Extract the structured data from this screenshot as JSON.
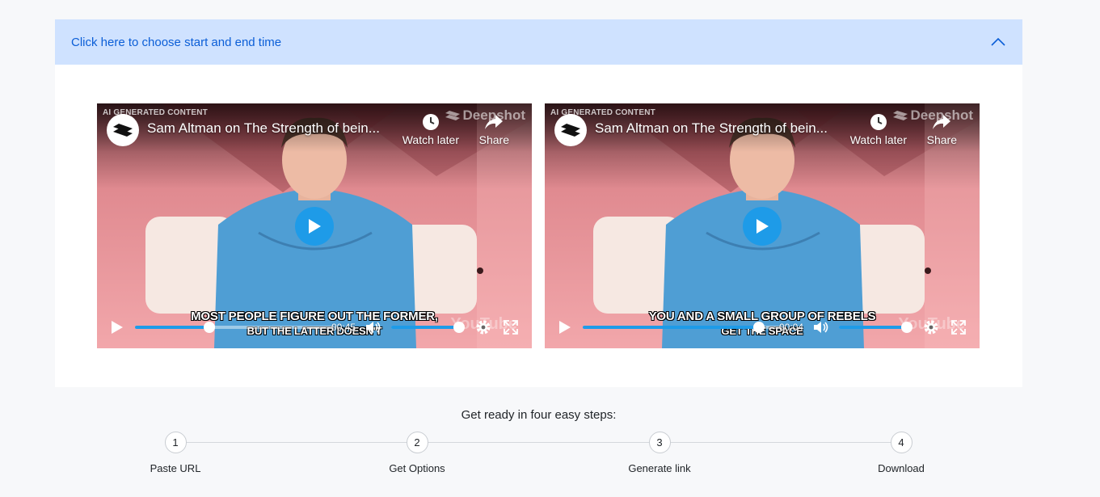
{
  "accordion": {
    "title": "Click here to choose start and end time"
  },
  "players": [
    {
      "ai_tag": "AI GENERATED CONTENT",
      "title": "Sam Altman on The Strength of bein...",
      "watermark": "Deepshot",
      "watch_later_label": "Watch later",
      "share_label": "Share",
      "caption_line1": "MOST PEOPLE FIGURE OUT THE FORMER,",
      "caption_line2": "BUT THE LATTER DOESN'T",
      "yt_watermark": "YouTube",
      "time": "-00:45",
      "progress": 0.37,
      "volume": 1.0
    },
    {
      "ai_tag": "AI GENERATED CONTENT",
      "title": "Sam Altman on The Strength of bein...",
      "watermark": "Deepshot",
      "watch_later_label": "Watch later",
      "share_label": "Share",
      "caption_line1": "YOU AND A SMALL GROUP OF REBELS",
      "caption_line2": "GET THE SPACE",
      "yt_watermark": "YouTube",
      "time": "-00:04",
      "progress": 0.88,
      "volume": 1.0
    }
  ],
  "steps": {
    "title": "Get ready in four easy steps:",
    "items": [
      {
        "number": "1",
        "label": "Paste URL"
      },
      {
        "number": "2",
        "label": "Get Options"
      },
      {
        "number": "3",
        "label": "Generate link"
      },
      {
        "number": "4",
        "label": "Download"
      }
    ]
  },
  "colors": {
    "accordion_bg": "#cfe2ff",
    "accordion_text": "#0b5ed7",
    "player_accent": "#1e9be8"
  },
  "icons": [
    "chevron-up-icon",
    "brand-logo-icon",
    "clock-icon",
    "share-arrow-icon",
    "play-icon",
    "volume-icon",
    "gear-icon",
    "fullscreen-icon"
  ]
}
